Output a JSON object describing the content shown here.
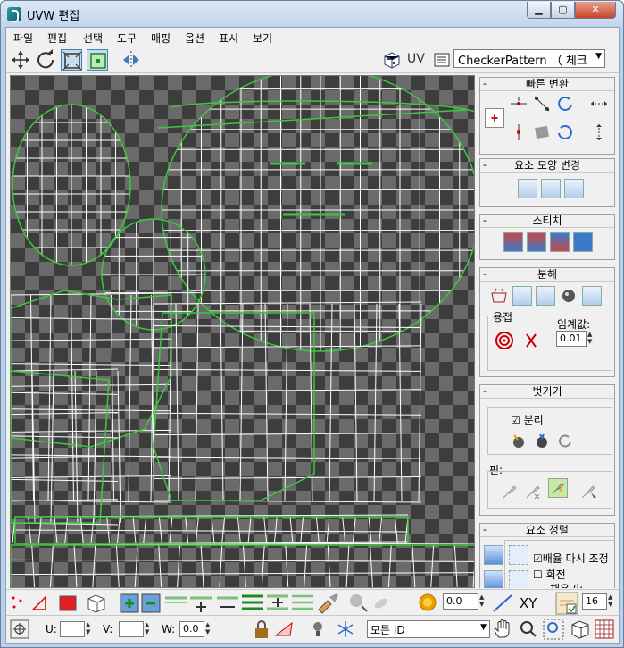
{
  "window": {
    "title": "UVW 편집",
    "minimize": "▁",
    "maximize": "▢",
    "close": "✕"
  },
  "menu": [
    "파일",
    "편집",
    "선택",
    "도구",
    "매핑",
    "옵션",
    "표시",
    "보기"
  ],
  "toolbar": {
    "tools": [
      "move-tool-icon",
      "rotate-tool-icon",
      "scale-tool-icon",
      "freeform-tool-icon",
      "mirror-tool-icon"
    ],
    "uv_label": "UV",
    "texture_dropdown": "CheckerPattern （ 체크"
  },
  "panel": {
    "quick_transform": {
      "title": "빠른 변환"
    },
    "reshape": {
      "title": "요소 모양 변경"
    },
    "stitch": {
      "title": "스티치"
    },
    "explode": {
      "title": "분해",
      "weld_label": "용접",
      "threshold_label": "임계값:",
      "threshold_value": "0.01"
    },
    "peel": {
      "title": "벗기기",
      "detach_label": "분리",
      "detach_checked": true,
      "pins_label": "핀:"
    },
    "arrange": {
      "title": "요소 정렬",
      "rescale_label": "배율 다시 조정",
      "rescale_checked": true,
      "rotate_label": "회전",
      "rotate_checked": false,
      "padding_label": "채우기:"
    }
  },
  "bottom_bar": {
    "spinner_value": "0.0",
    "xy_label": "XY",
    "grid_value": "16",
    "u_label": "U:",
    "u_value": "",
    "v_label": "V:",
    "v_value": "",
    "w_label": "W:",
    "w_value": "0.0",
    "id_dropdown": "모든 ID"
  },
  "colors": {
    "accent": "#1a8a1a",
    "checker_dark": "#3d3d3d",
    "checker_light": "#6a6a6a",
    "mesh": "#ffffff",
    "seam": "#3ec83e"
  }
}
